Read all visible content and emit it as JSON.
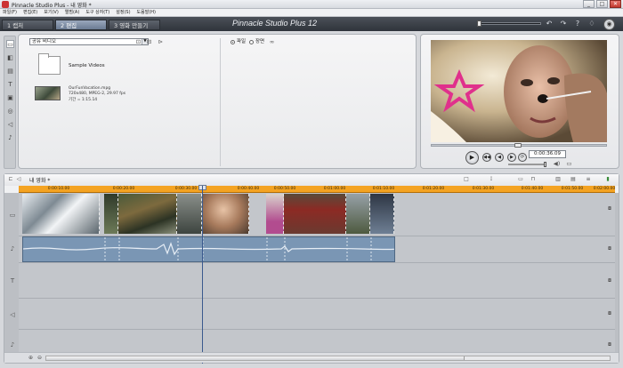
{
  "window": {
    "title": "Pinnacle Studio Plus - 내 영화 *",
    "controls": [
      "_",
      "□",
      "✕"
    ]
  },
  "menu": [
    "파일(F)",
    "편집(E)",
    "보기(V)",
    "앨범(A)",
    "도구 상자(T)",
    "설정(S)",
    "도움말(H)"
  ],
  "steps": {
    "tabs": [
      "1 캡처",
      "2 편집",
      "3 영화 만들기"
    ],
    "active_index": 1,
    "app_title": "Pinnacle Studio Plus 12",
    "header_icons": [
      "undo-icon",
      "redo-icon",
      "help-icon",
      "tip-icon",
      "trash-icon"
    ]
  },
  "album": {
    "section": "공유 비디오",
    "view_options": {
      "file": "파일",
      "scene": "장면"
    },
    "items": [
      {
        "type": "folder",
        "name": "Sample Videos"
      },
      {
        "type": "video",
        "filename": "OurFunVacation.mpg",
        "format": "720x480, MPEG-2, 29.97 fps",
        "duration": "기간 = 1:15.14"
      }
    ]
  },
  "player": {
    "timecode": "0:00:36.09",
    "scrub_position": 0.47,
    "volume": 0.95
  },
  "timeline": {
    "project_name": "내 영화 *",
    "ruler": [
      "0:00:10.00",
      "0:00:20.00",
      "0:00:30.00",
      "0:00:40.00",
      "0:00:50.00",
      "0:01:00.00",
      "0:01:10.00",
      "0:01:20.00",
      "0:01:30.00",
      "0:01:40.00",
      "0:01:50.00",
      "0:02:00.00"
    ],
    "tracks": [
      "video-track",
      "audio-track",
      "title-track",
      "sound-effect-track",
      "music-track"
    ],
    "clip_count": 8
  },
  "colors": {
    "ruler": "#f4a322",
    "audio_clip": "#7a96b4",
    "header": "#3c4148",
    "playhead": "#3b5a8e"
  }
}
